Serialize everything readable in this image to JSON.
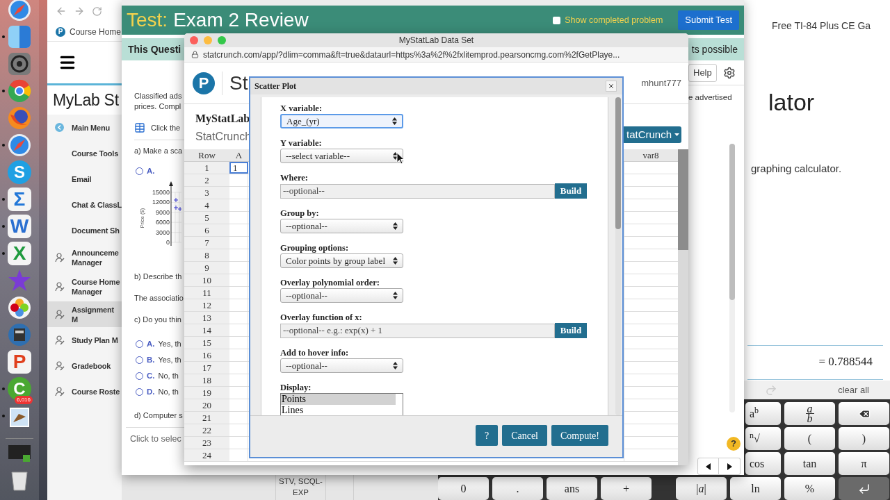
{
  "dock": [
    {
      "kind": "compass",
      "running": false
    },
    {
      "kind": "finder",
      "running": true
    },
    {
      "kind": "gear",
      "running": false
    },
    {
      "kind": "chrome",
      "running": true
    },
    {
      "kind": "firefox",
      "running": false
    },
    {
      "kind": "compass",
      "running": true
    },
    {
      "kind": "tile",
      "glyph": "S",
      "color": "#1fa0e3",
      "running": false
    },
    {
      "kind": "glyph",
      "glyph": "Σ",
      "color": "#2277d8",
      "running": true
    },
    {
      "kind": "glyph",
      "glyph": "W",
      "color": "#2a6fd1",
      "running": true
    },
    {
      "kind": "glyph",
      "glyph": "X",
      "color": "#1f9a3e",
      "running": true
    },
    {
      "kind": "star",
      "running": false
    },
    {
      "kind": "photos",
      "running": false
    },
    {
      "kind": "scanner",
      "running": false
    },
    {
      "kind": "glyph",
      "glyph": "P",
      "color": "#e0401e",
      "running": false
    },
    {
      "kind": "tile",
      "glyph": "C",
      "color": "#4aa832",
      "running": true
    },
    {
      "kind": "mail",
      "badge": "6,016",
      "running": true
    },
    {
      "kind": "thumbnail",
      "running": false
    },
    {
      "kind": "trash",
      "running": false
    }
  ],
  "mylab_window": {
    "logo_glyph": "P",
    "tab": "Course Home",
    "heading": "MyLab St",
    "sidebar": {
      "items": [
        {
          "kind": "back",
          "label": "Main Menu",
          "selected": false
        },
        {
          "kind": "plain",
          "label": "Course Tools",
          "selected": false
        },
        {
          "kind": "plain",
          "label": "Email",
          "selected": false
        },
        {
          "kind": "plain",
          "label": "Chat & ClassL",
          "selected": false
        },
        {
          "kind": "plain",
          "label": "Document Sh",
          "selected": false
        },
        {
          "kind": "manager",
          "label": "Announceme Manager",
          "selected": false
        },
        {
          "kind": "manager",
          "label": "Course Home Manager",
          "selected": false
        },
        {
          "kind": "manager",
          "label": "Assignment M",
          "selected": true
        },
        {
          "kind": "manager",
          "label": "Study Plan M",
          "selected": false
        },
        {
          "kind": "manager",
          "label": "Gradebook",
          "selected": false
        },
        {
          "kind": "manager",
          "label": "Course Roste",
          "selected": false
        }
      ]
    }
  },
  "back_window": {
    "cell": "STV, SCQL-EXP"
  },
  "calculator_window": {
    "tab": "Free TI-84 Plus CE Ga",
    "heading": "lator",
    "text": "graphing calculator.",
    "result": "= 0.788544",
    "clear": "clear all",
    "keys": [
      [
        {
          "kind": "text",
          "label": "a$^{b}$"
        },
        {
          "kind": "fraction",
          "num": "a",
          "den": "b"
        },
        {
          "kind": "backspace"
        }
      ],
      [
        {
          "kind": "text",
          "label": "$^{n}$√"
        },
        {
          "kind": "text",
          "label": "("
        },
        {
          "kind": "text",
          "label": ")"
        }
      ],
      [
        {
          "kind": "text",
          "label": "cos"
        },
        {
          "kind": "text",
          "label": "tan"
        },
        {
          "kind": "text",
          "label": "π"
        }
      ],
      [
        {
          "kind": "text",
          "label": "0"
        },
        {
          "kind": "text",
          "label": "."
        },
        {
          "kind": "text",
          "label": "ans"
        },
        {
          "kind": "text",
          "label": "+"
        },
        {
          "kind": "text",
          "label": "|*a*|"
        },
        {
          "kind": "text",
          "label": "ln"
        },
        {
          "kind": "text",
          "label": "%"
        },
        {
          "kind": "enter"
        }
      ]
    ]
  },
  "test_window": {
    "title_label": "Test:",
    "title": "Exam 2 Review",
    "show_completed": {
      "label": "Show completed problem",
      "checked": false
    },
    "submit": "Submit Test",
    "question_bar": {
      "left": "This Questi",
      "right": "ts possible"
    },
    "help": "Help",
    "intro": [
      "Classified ads",
      "prices. Compl"
    ],
    "data_link": "Click the",
    "part_a": "a) Make a sca",
    "part_a_option": {
      "letter": "A.",
      "selected": false
    },
    "chart_picture": {
      "ylabel": "Price ($)",
      "tick_labels": [
        "15000",
        "12000",
        "9000",
        "6000",
        "3000",
        "0"
      ]
    },
    "part_b": "b) Describe th",
    "part_b_answer": "The associatio",
    "part_c": "c) Do you thin",
    "options": [
      {
        "letter": "A.",
        "text": "Yes, th",
        "selected": false
      },
      {
        "letter": "B.",
        "text": "Yes, th",
        "selected": false
      },
      {
        "letter": "C.",
        "text": "No, th",
        "selected": false
      },
      {
        "letter": "D.",
        "text": "No, th",
        "selected": false
      }
    ],
    "part_d": "d) Computer s",
    "select_hint": "Click to selec",
    "side_text": "e advertised",
    "help_badge": "?"
  },
  "statcrunch_window": {
    "title": "MyStatLab Data Set",
    "url": "statcrunch.com/app/?dlim=comma&ft=true&dataurl=https%3a%2f%2fxlitemprod.pearsoncmg.com%2fGetPlaye...",
    "logo_glyph": "P",
    "brand": "St",
    "user": "mhunt777",
    "heading": "MyStatLab",
    "subheading": "StatCrunch",
    "menu_button": "tatCrunch",
    "columns": [
      "Row",
      "A",
      "var8"
    ],
    "rows": [
      {
        "row": "1",
        "a": "1",
        "selected": true
      },
      {
        "row": "2",
        "selected": false
      },
      {
        "row": "3",
        "selected": false
      },
      {
        "row": "4",
        "selected": false
      },
      {
        "row": "5",
        "selected": false
      },
      {
        "row": "6",
        "selected": false
      },
      {
        "row": "7",
        "selected": false
      },
      {
        "row": "8",
        "selected": false
      },
      {
        "row": "9",
        "selected": false
      },
      {
        "row": "10",
        "selected": false
      },
      {
        "row": "11",
        "selected": false
      },
      {
        "row": "12",
        "selected": false
      },
      {
        "row": "13",
        "selected": false
      },
      {
        "row": "14",
        "selected": false
      },
      {
        "row": "15",
        "selected": false
      },
      {
        "row": "16",
        "selected": false
      },
      {
        "row": "17",
        "selected": false
      },
      {
        "row": "18",
        "selected": false
      },
      {
        "row": "19",
        "selected": false
      },
      {
        "row": "20",
        "selected": false
      },
      {
        "row": "21",
        "selected": false
      },
      {
        "row": "22",
        "selected": false
      },
      {
        "row": "23",
        "selected": false
      },
      {
        "row": "24",
        "selected": false
      }
    ]
  },
  "scatter_dialog": {
    "title": "Scatter Plot",
    "fields": [
      {
        "kind": "select",
        "label": "X variable:",
        "value": "Age_(yr)",
        "focused": true
      },
      {
        "kind": "select",
        "label": "Y variable:",
        "value": "--select variable--",
        "focused": false
      },
      {
        "kind": "input",
        "label": "Where:",
        "placeholder": "--optional--",
        "button": "Build"
      },
      {
        "kind": "select",
        "label": "Group by:",
        "value": "--optional--",
        "focused": false
      },
      {
        "kind": "select",
        "label": "Grouping options:",
        "value": "Color points by group label",
        "focused": false
      },
      {
        "kind": "select",
        "label": "Overlay polynomial order:",
        "value": "--optional--",
        "focused": false
      },
      {
        "kind": "input",
        "label": "Overlay function of x:",
        "placeholder": "--optional-- e.g.: exp(x) + 1",
        "button": "Build"
      },
      {
        "kind": "select",
        "label": "Add to hover info:",
        "value": "--optional--",
        "focused": false
      },
      {
        "kind": "listbox",
        "label": "Display:",
        "options": [
          {
            "label": "Points",
            "selected": true
          },
          {
            "label": "Lines",
            "selected": false
          }
        ]
      }
    ],
    "buttons": [
      "?",
      "Cancel",
      "Compute!"
    ]
  }
}
